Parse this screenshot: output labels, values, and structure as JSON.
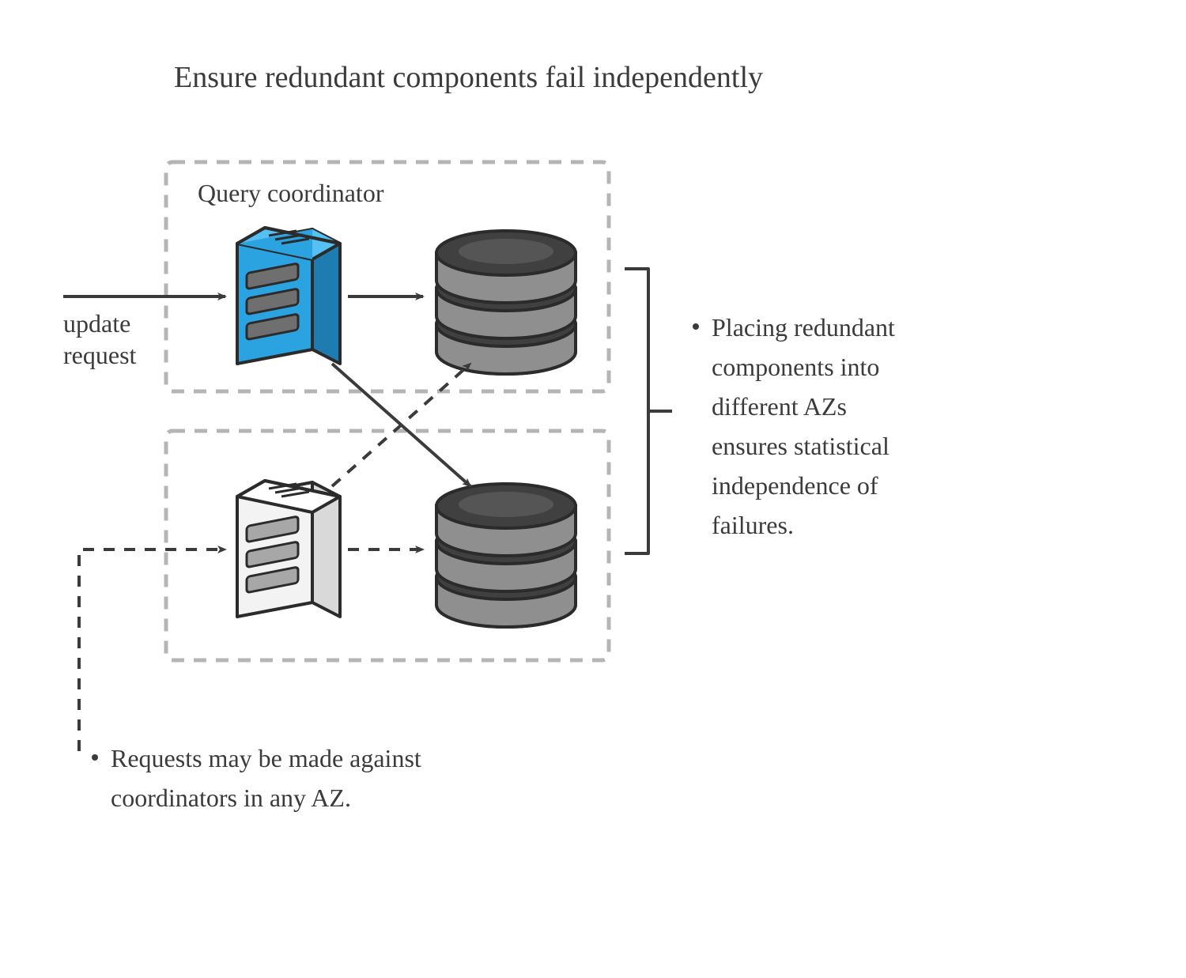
{
  "title": "Ensure redundant components fail independently",
  "labels": {
    "query_coordinator": "Query coordinator",
    "update_request_1": "update",
    "update_request_2": "request"
  },
  "bullets": {
    "right_1": "Placing redundant",
    "right_2": "components into",
    "right_3": "different AZs",
    "right_4": "ensures statistical",
    "right_5": "independence of",
    "right_6": "failures.",
    "bottom_1": "Requests may be made against",
    "bottom_2": "coordinators in any AZ."
  },
  "colors": {
    "stroke": "#3b3b3b",
    "box_dash": "#b5b5b5",
    "server_primary_fill": "#2aa3e0",
    "server_primary_dark": "#1e7cb0",
    "server_primary_light": "#56c0f2",
    "server_secondary_fill": "#f3f3f3",
    "server_secondary_dark": "#d9d9d9",
    "db_dark": "#404040",
    "db_mid": "#8f8f8f",
    "db_light": "#b8b8b8"
  }
}
